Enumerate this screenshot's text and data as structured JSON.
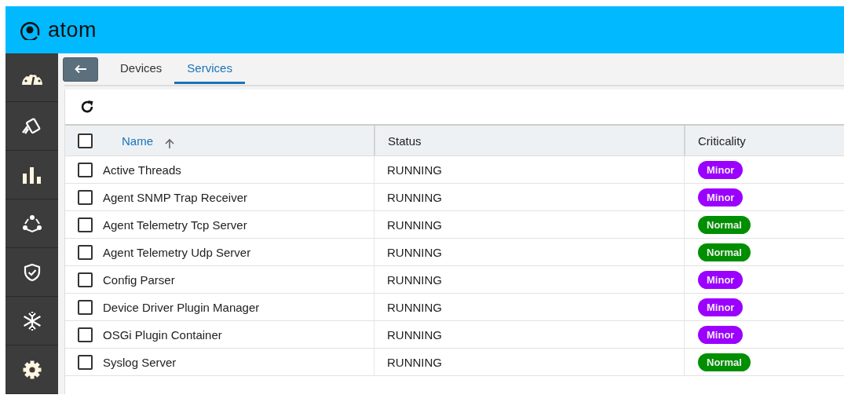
{
  "header": {
    "logo": "atom"
  },
  "tabs": [
    {
      "label": "Devices",
      "selected": false
    },
    {
      "label": "Services",
      "selected": true
    }
  ],
  "table": {
    "select_all": {
      "checked": false
    },
    "columns": [
      {
        "label": "Name"
      },
      {
        "label": "Status"
      },
      {
        "label": "Criticality"
      }
    ],
    "rows": [
      {
        "checked": false,
        "name": "Active Threads",
        "status": "RUNNING",
        "criticality": "Minor",
        "color": "#9b00ff"
      },
      {
        "checked": false,
        "name": "Agent SNMP Trap Receiver",
        "status": "RUNNING",
        "criticality": "Minor",
        "color": "#9b00ff"
      },
      {
        "checked": false,
        "name": "Agent Telemetry Tcp Server",
        "status": "RUNNING",
        "criticality": "Normal",
        "color": "#008f00"
      },
      {
        "checked": false,
        "name": "Agent Telemetry Udp Server",
        "status": "RUNNING",
        "criticality": "Normal",
        "color": "#008f00"
      },
      {
        "checked": false,
        "name": "Config Parser",
        "status": "RUNNING",
        "criticality": "Minor",
        "color": "#9b00ff"
      },
      {
        "checked": false,
        "name": "Device Driver Plugin Manager",
        "status": "RUNNING",
        "criticality": "Minor",
        "color": "#9b00ff"
      },
      {
        "checked": false,
        "name": "OSGi Plugin Container",
        "status": "RUNNING",
        "criticality": "Minor",
        "color": "#9b00ff"
      },
      {
        "checked": false,
        "name": "Syslog Server",
        "status": "RUNNING",
        "criticality": "Normal",
        "color": "#008f00"
      }
    ]
  }
}
